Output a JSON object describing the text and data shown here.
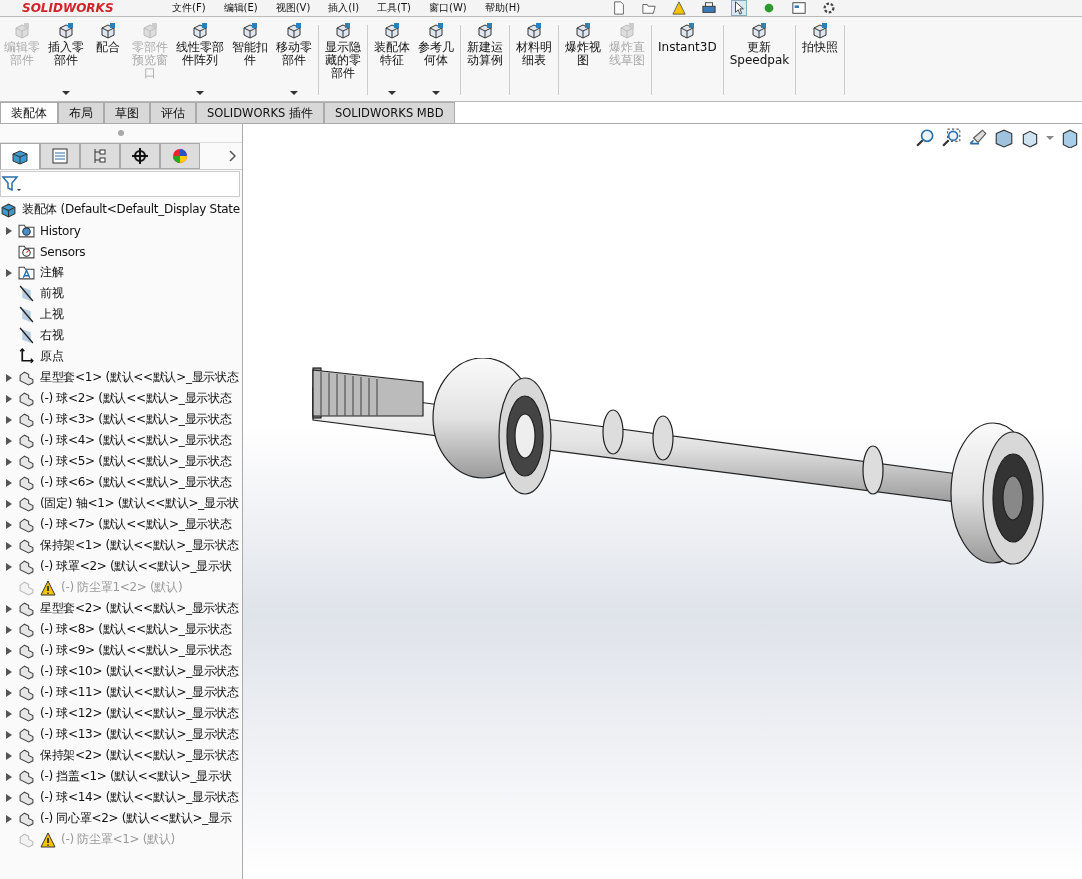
{
  "app": {
    "logo": "SOLIDWORKS"
  },
  "menu": [
    "文件(F)",
    "编辑(E)",
    "视图(V)",
    "插入(I)",
    "工具(T)",
    "窗口(W)",
    "帮助(H)"
  ],
  "toolbar": {
    "groups": [
      [
        {
          "lines": [
            "编辑零",
            "部件"
          ],
          "disabled": true,
          "dropdown": false
        },
        {
          "lines": [
            "插入零",
            "部件"
          ],
          "disabled": false,
          "dropdown": true
        },
        {
          "lines": [
            "配合"
          ],
          "disabled": false,
          "dropdown": false
        },
        {
          "lines": [
            "零部件",
            "预览窗",
            "口"
          ],
          "disabled": true,
          "dropdown": false
        },
        {
          "lines": [
            "线性零部",
            "件阵列"
          ],
          "disabled": false,
          "dropdown": true
        },
        {
          "lines": [
            "智能扣",
            "件"
          ],
          "disabled": false,
          "dropdown": false
        },
        {
          "lines": [
            "移动零",
            "部件"
          ],
          "disabled": false,
          "dropdown": true
        }
      ],
      [
        {
          "lines": [
            "显示隐",
            "藏的零",
            "部件"
          ],
          "disabled": false,
          "dropdown": false
        }
      ],
      [
        {
          "lines": [
            "装配体",
            "特征"
          ],
          "disabled": false,
          "dropdown": true
        },
        {
          "lines": [
            "参考几",
            "何体"
          ],
          "disabled": false,
          "dropdown": true
        }
      ],
      [
        {
          "lines": [
            "新建运",
            "动算例"
          ],
          "disabled": false,
          "dropdown": false
        }
      ],
      [
        {
          "lines": [
            "材料明",
            "细表"
          ],
          "disabled": false,
          "dropdown": false
        }
      ],
      [
        {
          "lines": [
            "爆炸视",
            "图"
          ],
          "disabled": false,
          "dropdown": false
        },
        {
          "lines": [
            "爆炸直",
            "线草图"
          ],
          "disabled": true,
          "dropdown": false
        }
      ],
      [
        {
          "lines": [
            "Instant3D"
          ],
          "disabled": false,
          "dropdown": false
        }
      ],
      [
        {
          "lines": [
            "更新",
            "Speedpak"
          ],
          "disabled": false,
          "dropdown": false
        }
      ],
      [
        {
          "lines": [
            "拍快照"
          ],
          "disabled": false,
          "dropdown": false
        }
      ]
    ]
  },
  "tabs": [
    {
      "label": "装配体",
      "selected": true
    },
    {
      "label": "布局",
      "selected": false
    },
    {
      "label": "草图",
      "selected": false
    },
    {
      "label": "评估",
      "selected": false
    },
    {
      "label": "SOLIDWORKS 插件",
      "selected": false
    },
    {
      "label": "SOLIDWORKS MBD",
      "selected": false
    }
  ],
  "tree": {
    "root": "装配体  (Default<Default_Display State",
    "items": [
      {
        "kind": "folder",
        "label": "History",
        "expandable": true,
        "suppressed": false
      },
      {
        "kind": "sensor",
        "label": "Sensors",
        "expandable": false,
        "suppressed": false
      },
      {
        "kind": "annotation",
        "label": "注解",
        "expandable": true,
        "suppressed": false
      },
      {
        "kind": "plane",
        "label": "前视",
        "expandable": false,
        "suppressed": false
      },
      {
        "kind": "plane",
        "label": "上视",
        "expandable": false,
        "suppressed": false
      },
      {
        "kind": "plane",
        "label": "右视",
        "expandable": false,
        "suppressed": false
      },
      {
        "kind": "origin",
        "label": "原点",
        "expandable": false,
        "suppressed": false
      },
      {
        "kind": "part",
        "label": "星型套<1> (默认<<默认>_显示状态",
        "expandable": true,
        "suppressed": false
      },
      {
        "kind": "part",
        "label": "(-) 球<2> (默认<<默认>_显示状态",
        "expandable": true,
        "suppressed": false
      },
      {
        "kind": "part",
        "label": "(-) 球<3> (默认<<默认>_显示状态",
        "expandable": true,
        "suppressed": false
      },
      {
        "kind": "part",
        "label": "(-) 球<4> (默认<<默认>_显示状态",
        "expandable": true,
        "suppressed": false
      },
      {
        "kind": "part",
        "label": "(-) 球<5> (默认<<默认>_显示状态",
        "expandable": true,
        "suppressed": false
      },
      {
        "kind": "part",
        "label": "(-) 球<6> (默认<<默认>_显示状态",
        "expandable": true,
        "suppressed": false
      },
      {
        "kind": "part",
        "label": "(固定) 轴<1> (默认<<默认>_显示状",
        "expandable": true,
        "suppressed": false
      },
      {
        "kind": "part",
        "label": "(-) 球<7> (默认<<默认>_显示状态",
        "expandable": true,
        "suppressed": false
      },
      {
        "kind": "part",
        "label": "保持架<1> (默认<<默认>_显示状态",
        "expandable": true,
        "suppressed": false
      },
      {
        "kind": "part",
        "label": "(-) 球罩<2> (默认<<默认>_显示状",
        "expandable": true,
        "suppressed": false
      },
      {
        "kind": "part",
        "label": "(-) 防尘罩1<2> (默认)",
        "expandable": false,
        "suppressed": true
      },
      {
        "kind": "part",
        "label": "星型套<2> (默认<<默认>_显示状态",
        "expandable": true,
        "suppressed": false
      },
      {
        "kind": "part",
        "label": "(-) 球<8> (默认<<默认>_显示状态",
        "expandable": true,
        "suppressed": false
      },
      {
        "kind": "part",
        "label": "(-) 球<9> (默认<<默认>_显示状态",
        "expandable": true,
        "suppressed": false
      },
      {
        "kind": "part",
        "label": "(-) 球<10> (默认<<默认>_显示状态",
        "expandable": true,
        "suppressed": false
      },
      {
        "kind": "part",
        "label": "(-) 球<11> (默认<<默认>_显示状态",
        "expandable": true,
        "suppressed": false
      },
      {
        "kind": "part",
        "label": "(-) 球<12> (默认<<默认>_显示状态",
        "expandable": true,
        "suppressed": false
      },
      {
        "kind": "part",
        "label": "(-) 球<13> (默认<<默认>_显示状态",
        "expandable": true,
        "suppressed": false
      },
      {
        "kind": "part",
        "label": "保持架<2> (默认<<默认>_显示状态",
        "expandable": true,
        "suppressed": false
      },
      {
        "kind": "part",
        "label": "(-) 挡盖<1> (默认<<默认>_显示状",
        "expandable": true,
        "suppressed": false
      },
      {
        "kind": "part",
        "label": "(-) 球<14> (默认<<默认>_显示状态",
        "expandable": true,
        "suppressed": false
      },
      {
        "kind": "part",
        "label": "(-) 同心罩<2> (默认<<默认>_显示",
        "expandable": true,
        "suppressed": false
      },
      {
        "kind": "part",
        "label": "(-) 防尘罩<1> (默认)",
        "expandable": false,
        "suppressed": true
      }
    ]
  }
}
